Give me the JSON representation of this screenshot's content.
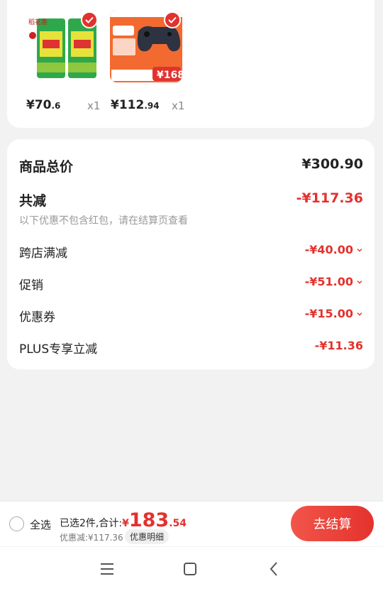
{
  "products": [
    {
      "price_int": "¥70",
      "price_dec": ".6",
      "qty": "x1",
      "image": "rice-bag-image",
      "image_text": "稻花香"
    },
    {
      "price_int": "¥112",
      "price_dec": ".94",
      "qty": "x1",
      "image": "game-controller-image",
      "image_promo": "¥168"
    }
  ],
  "summary": {
    "total_label": "商品总价",
    "total_value": "¥300.90",
    "reduce_label": "共减",
    "reduce_value": "-¥117.36",
    "note": "以下优惠不包含红包，请在结算页查看",
    "items": [
      {
        "label": "跨店满减",
        "value": "-¥40.00"
      },
      {
        "label": "促销",
        "value": "-¥51.00"
      },
      {
        "label": "优惠券",
        "value": "-¥15.00"
      },
      {
        "label": "PLUS专享立减",
        "value": "-¥11.36"
      }
    ]
  },
  "bottom": {
    "select_all": "全选",
    "selected_text": "已选2件,合计:",
    "currency": "¥",
    "total_int": "183",
    "total_dec": ".54",
    "discount_text": "优惠减:¥117.36",
    "detail_label": "优惠明细",
    "checkout_label": "去结算"
  },
  "colors": {
    "accent": "#e2322e",
    "background": "#f2f2f2"
  }
}
